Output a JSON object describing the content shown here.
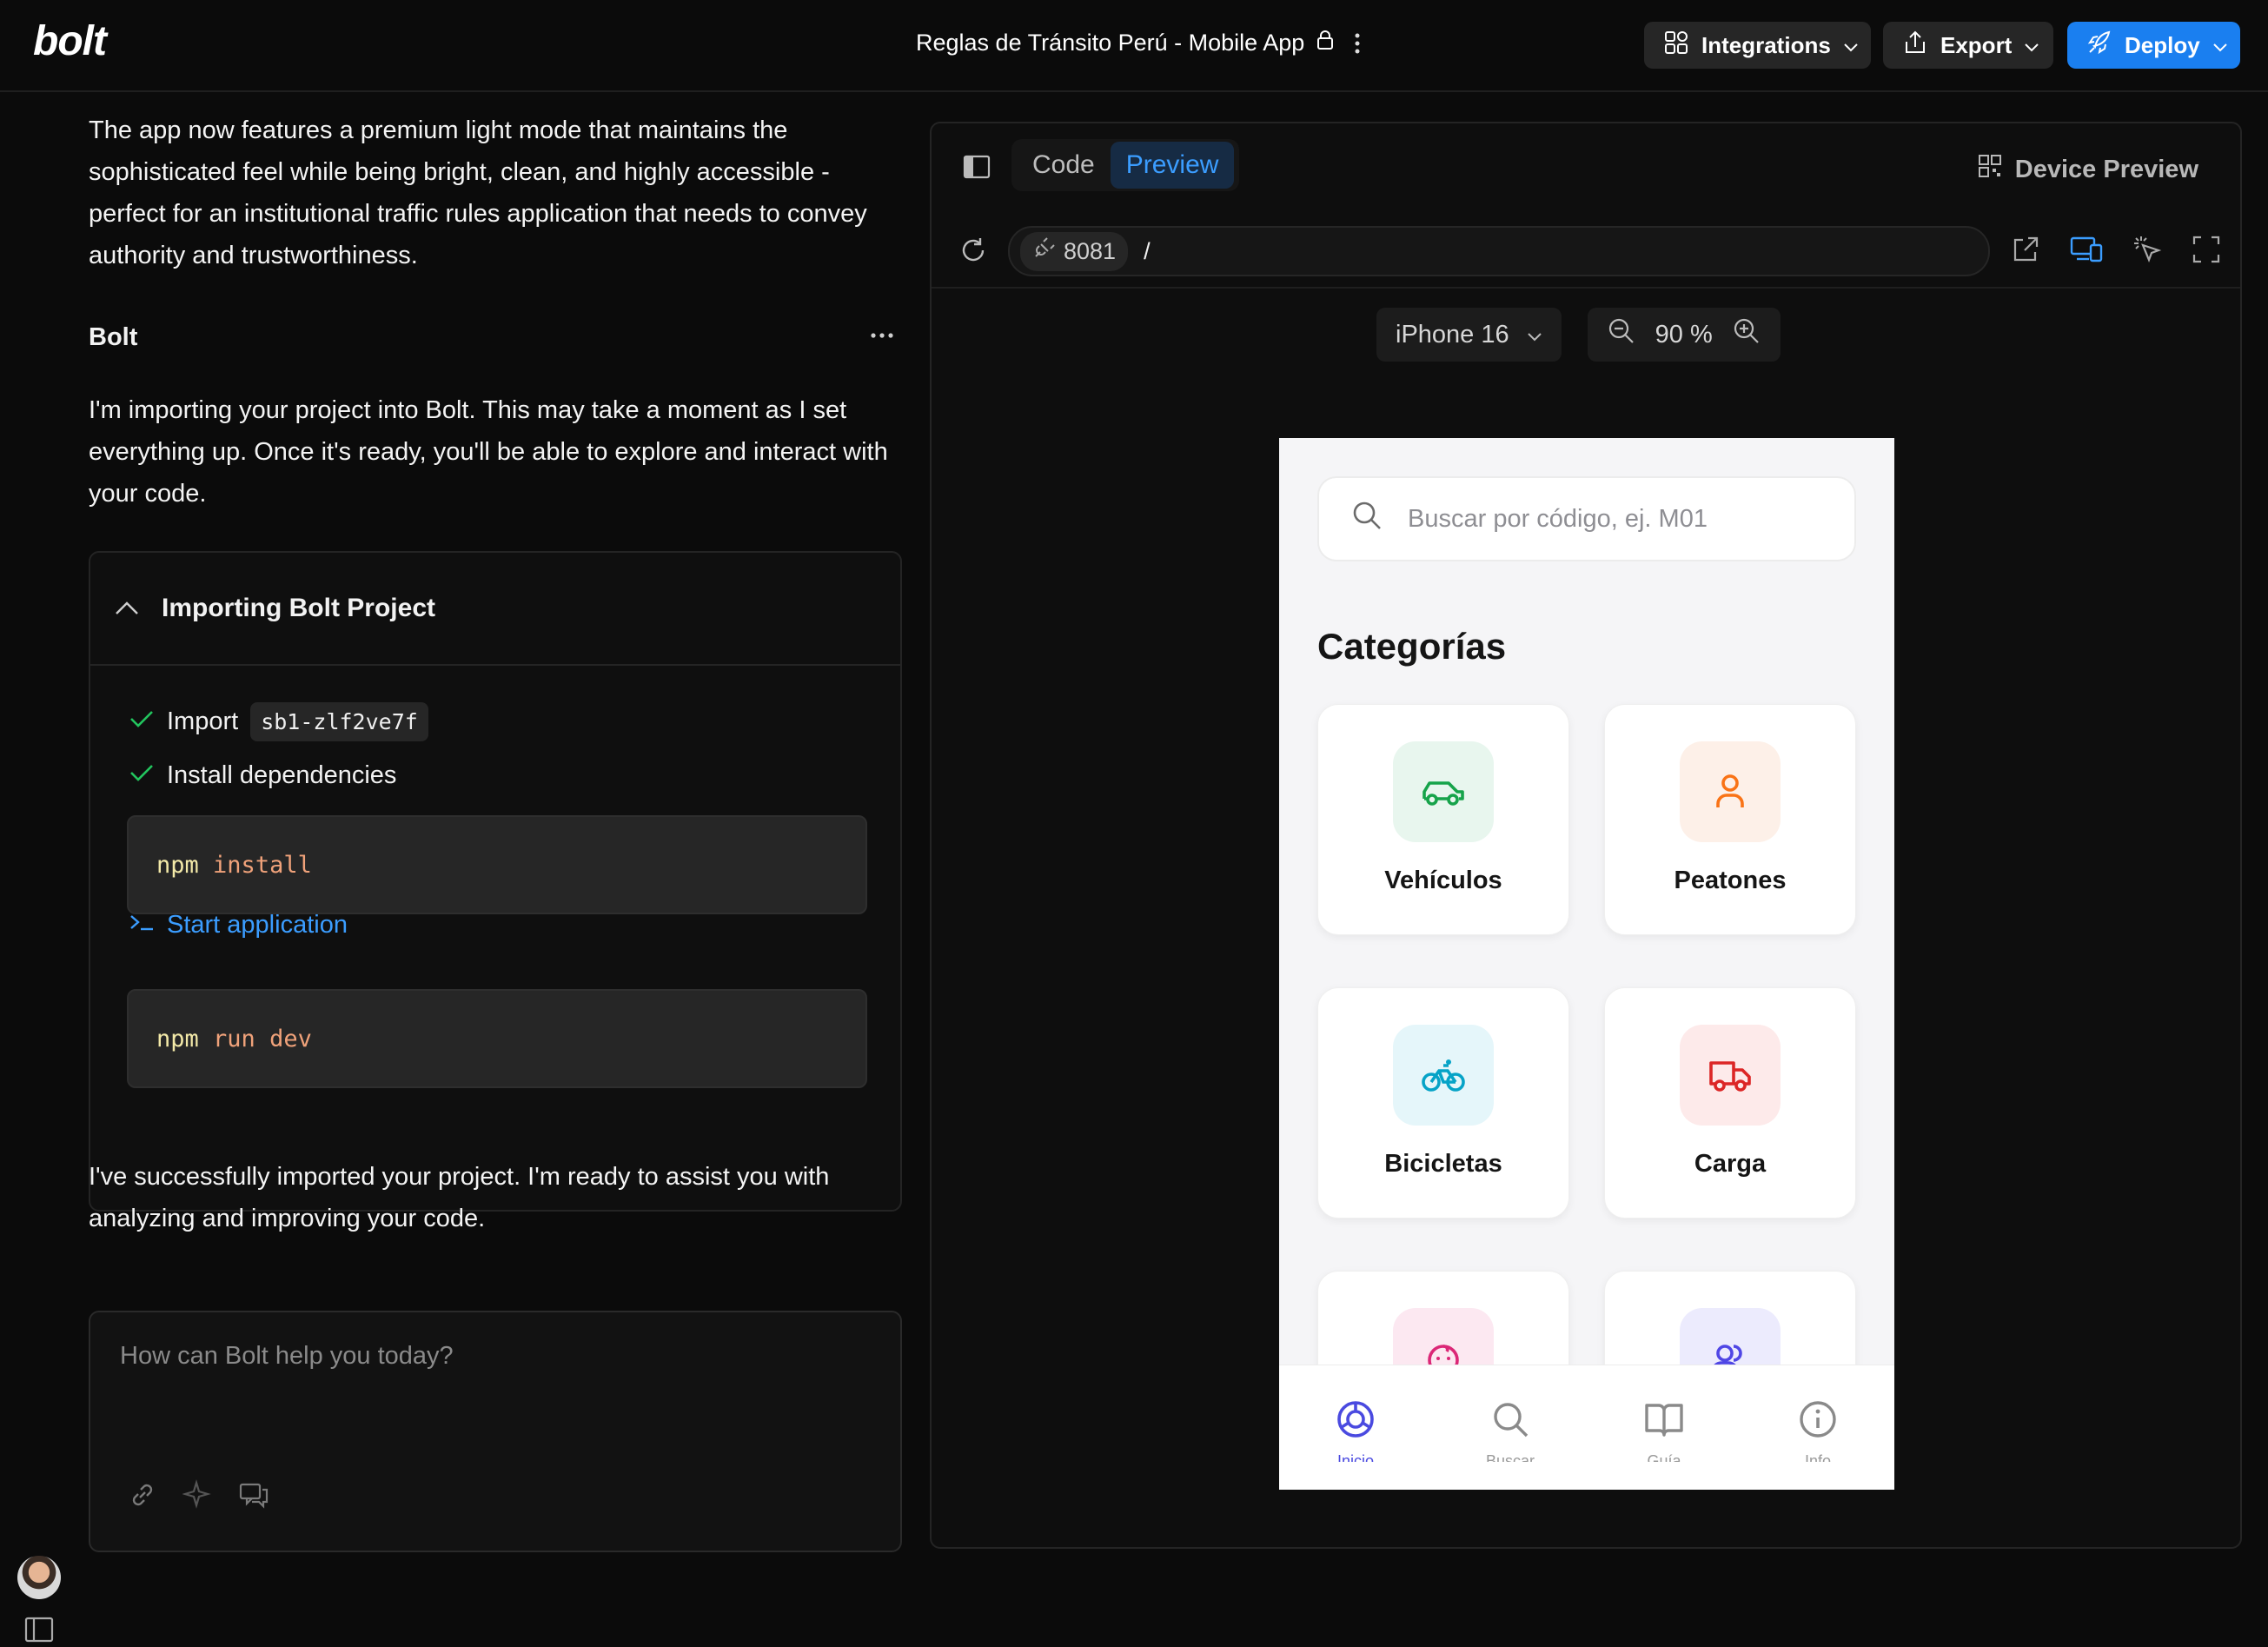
{
  "header": {
    "logo": "bolt",
    "project_title": "Reglas de Tránsito Perú - Mobile App",
    "integrations_label": "Integrations",
    "export_label": "Export",
    "deploy_label": "Deploy"
  },
  "chat": {
    "intro_text": "The app now features a premium light mode that maintains the sophisticated feel while being bright, clean, and highly accessible - perfect for an institutional traffic rules application that needs to convey authority and trustworthiness.",
    "author": "Bolt",
    "import_message": "I'm importing your project into Bolt. This may take a moment as I set everything up. Once it's ready, you'll be able to explore and interact with your code.",
    "import_box": {
      "title": "Importing Bolt Project",
      "step_import": "Import",
      "project_id": "sb1-zlf2ve7f",
      "step_install": "Install dependencies",
      "install_cmd": "npm",
      "install_args": "install",
      "step_start": "Start application",
      "start_cmd": "npm",
      "start_args": "run dev"
    },
    "success_message": "I've successfully imported your project. I'm ready to assist you with analyzing and improving your code.",
    "prompt_placeholder": "How can Bolt help you today?"
  },
  "preview": {
    "tab_code": "Code",
    "tab_preview": "Preview",
    "device_preview_label": "Device Preview",
    "port": "8081",
    "path": "/",
    "device": "iPhone 16",
    "zoom": "90 %"
  },
  "app": {
    "search_placeholder": "Buscar por código, ej. M01",
    "categories_title": "Categorías",
    "categories": [
      {
        "label": "Vehículos",
        "icon": "car-icon",
        "color": "#16a34a",
        "bg": "#e8f6ee"
      },
      {
        "label": "Peatones",
        "icon": "person-icon",
        "color": "#f97316",
        "bg": "#fdf0e8"
      },
      {
        "label": "Bicicletas",
        "icon": "bicycle-icon",
        "color": "#06a3c7",
        "bg": "#e5f6fa"
      },
      {
        "label": "Carga",
        "icon": "truck-icon",
        "color": "#dc2626",
        "bg": "#fdeaea"
      },
      {
        "label": "",
        "icon": "baby-icon",
        "color": "#db2777",
        "bg": "#fce8f1"
      },
      {
        "label": "",
        "icon": "users-icon",
        "color": "#4f46e5",
        "bg": "#ecebfd"
      }
    ],
    "nav": [
      {
        "label": "Inicio",
        "icon": "compass-icon"
      },
      {
        "label": "Buscar",
        "icon": "search-icon"
      },
      {
        "label": "Guía",
        "icon": "book-icon"
      },
      {
        "label": "Info",
        "icon": "info-icon"
      }
    ],
    "accent": "#4a4ae0"
  }
}
